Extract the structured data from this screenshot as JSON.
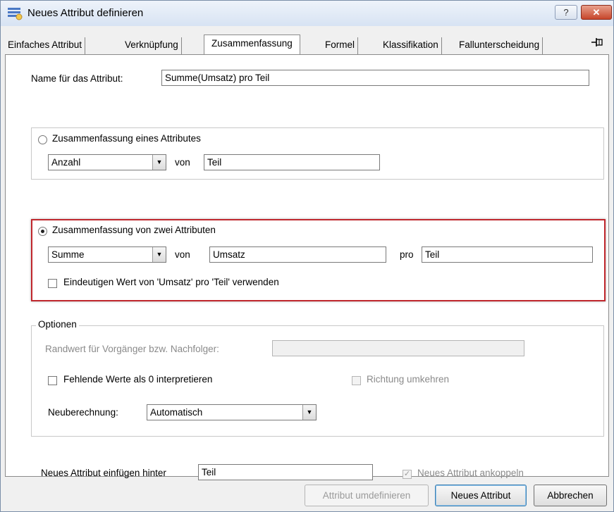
{
  "window": {
    "title": "Neues Attribut definieren",
    "help_button": "?",
    "close_button": "✕"
  },
  "tabs": [
    {
      "label": "Einfaches Attribut"
    },
    {
      "label": "Verknüpfung"
    },
    {
      "label": "Zusammenfassung"
    },
    {
      "label": "Formel"
    },
    {
      "label": "Klassifikation"
    },
    {
      "label": "Fallunterscheidung"
    }
  ],
  "active_tab": "Zusammenfassung",
  "pin_icon": "pin-icon",
  "form": {
    "name_label": "Name für das Attribut:",
    "name_value": "Summe(Umsatz) pro Teil",
    "single": {
      "radio_label": "Zusammenfassung eines Attributes",
      "selected": false,
      "function": "Anzahl",
      "von_label": "von",
      "attribute": "Teil"
    },
    "double": {
      "radio_label": "Zusammenfassung von zwei Attributen",
      "selected": true,
      "function": "Summe",
      "von_label": "von",
      "attribute": "Umsatz",
      "pro_label": "pro",
      "per_attribute": "Teil",
      "unique_label": "Eindeutigen Wert von 'Umsatz' pro 'Teil' verwenden",
      "unique_checked": false
    },
    "options": {
      "legend": "Optionen",
      "boundary_label": "Randwert für Vorgänger bzw. Nachfolger:",
      "boundary_value": "",
      "missing_label": "Fehlende Werte als 0 interpretieren",
      "missing_checked": false,
      "reverse_label": "Richtung umkehren",
      "reverse_checked": false,
      "recalc_label": "Neuberechnung:",
      "recalc_value": "Automatisch"
    },
    "insert_label": "Neues Attribut einfügen hinter",
    "insert_value": "Teil",
    "couple_label": "Neues Attribut ankoppeln",
    "couple_checked": true
  },
  "buttons": {
    "redefine": "Attribut umdefinieren",
    "new_attribute": "Neues Attribut",
    "cancel": "Abbrechen"
  },
  "colors": {
    "highlight_border": "#c0272d",
    "close_button": "#c7462b"
  }
}
